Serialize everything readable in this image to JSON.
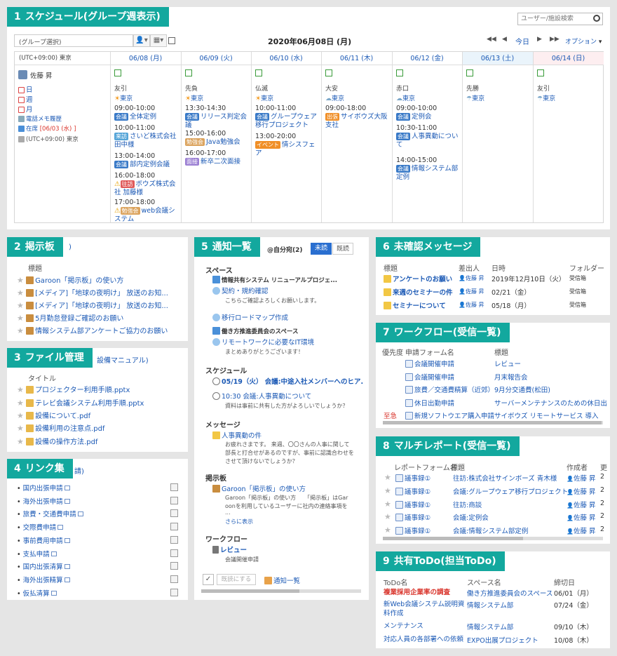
{
  "colors": {
    "accent": "#13a89e",
    "link": "#1b59b5",
    "red": "#d9342b"
  },
  "p1": {
    "num": "1",
    "title": "スケジュール(グループ週表示)",
    "search_placeholder": "ユーザー/施設検索",
    "group_select": "(グループ選択)",
    "date": "2020年06月08日 (月)",
    "today": "今日",
    "option": "オプション",
    "tz": "(UTC+09:00) 東京",
    "days": [
      {
        "label": "06/08 (月)",
        "rokuyo": "友引",
        "weather": "東京"
      },
      {
        "label": "06/09 (火)",
        "rokuyo": "先負",
        "weather": "東京"
      },
      {
        "label": "06/10 (水)",
        "rokuyo": "仏滅",
        "weather": "東京"
      },
      {
        "label": "06/11 (木)",
        "rokuyo": "大安",
        "weather": "東京"
      },
      {
        "label": "06/12 (金)",
        "rokuyo": "赤口",
        "weather": "東京"
      },
      {
        "label": "06/13 (土)",
        "rokuyo": "先勝",
        "weather": "東京"
      },
      {
        "label": "06/14 (日)",
        "rokuyo": "友引",
        "weather": "東京"
      }
    ],
    "user": {
      "name": "佐藤 昇",
      "links": [
        "日",
        "週",
        "月",
        "電話メモ履歴"
      ],
      "status_prefix": "在席",
      "status_date": "[06/03 (水) ]",
      "tz": "(UTC+09:00) 東京"
    },
    "events": {
      "d0": [
        {
          "time": "09:00-10:00",
          "badge": "会議",
          "text": "全体定例"
        },
        {
          "time": "10:00-11:00",
          "badge": "来訪",
          "text": "さいど株式会社 田中様"
        },
        {
          "time": "13:00-14:00",
          "badge": "会議",
          "text": "部内定例会議"
        },
        {
          "time": "16:00-18:00",
          "badge": "往訪",
          "text": "ボウズ株式会社 加藤様"
        },
        {
          "time": "17:00-18:00",
          "badge": "勉強会",
          "text": "web会議システム"
        }
      ],
      "d1": [
        {
          "time": "13:30-14:30",
          "badge": "会議",
          "text": "リリース判定会議"
        },
        {
          "time": "15:00-16:00",
          "badge": "勉強会",
          "text": "Java勉強会"
        },
        {
          "time": "16:00-17:00",
          "badge": "面接",
          "text": "新卒二次面接"
        }
      ],
      "d2": [
        {
          "time": "10:00-11:00",
          "badge": "会議",
          "text": "グループウェア移行プロジェクト"
        },
        {
          "time": "13:00-20:00",
          "badge": "イベント",
          "text": "情シスフェア"
        }
      ],
      "d3": [
        {
          "time": "09:00-18:00",
          "badge": "出張",
          "text": "サイボウズ大阪支社"
        }
      ],
      "d4": [
        {
          "time": "09:00-10:00",
          "badge": "会議",
          "text": "定例会"
        },
        {
          "time": "10:30-11:00",
          "badge": "会議",
          "text": "人事異動について"
        },
        {
          "time": "14:00-15:00",
          "badge": "会議",
          "text": "情報システム部定例"
        }
      ]
    }
  },
  "p2": {
    "num": "2",
    "title": "掲示板",
    "sub": ")",
    "col": "標題",
    "items": [
      "Garoon「掲示板」の使い方",
      "[メディア]「地球の夜明け」 放送のお知...",
      "[メディア]「地球の夜明け」 放送のお知...",
      "5月勤怠登録ご確認のお願い",
      "情報システム部アンケートご協力のお願い"
    ]
  },
  "p3": {
    "num": "3",
    "title": "ファイル管理",
    "sub": "設備マニュアル)",
    "col": "タイトル",
    "items": [
      "プロジェクター利用手順.pptx",
      "テレビ会議システム利用手順.pptx",
      "設備について.pdf",
      "設備利用の注意点.pdf",
      "設備の操作方法.pdf"
    ]
  },
  "p4": {
    "num": "4",
    "title": "リンク集",
    "sub": "請)",
    "items": [
      "国内出張申請",
      "海外出張申請",
      "旅費・交通費申請",
      "交際費申請",
      "事前費用申請",
      "支払申請",
      "国内出張清算",
      "海外出張精算",
      "仮払清算"
    ]
  },
  "p5": {
    "num": "5",
    "title": "通知一覧",
    "self": "@自分宛(2)",
    "tab_unread": "未読",
    "tab_read": "既読",
    "sections": {
      "space": "スペース",
      "schedule": "スケジュール",
      "message": "メッセージ",
      "board": "掲示板",
      "workflow": "ワークフロー"
    },
    "space_items": [
      {
        "group": "情報共有システム リニューアルプロジェ...",
        "title": "契約・規約確認",
        "body": "こちらご確認よろしくお願いします。"
      },
      {
        "title": "移行ロードマップ作成"
      },
      {
        "group": "働き方推進委員会のスペース",
        "title": "リモートワークに必要なIT環境",
        "body": "まとめありがとうございます！"
      }
    ],
    "sched_items": [
      {
        "title": "05/19（火） 会議:中途入社メンバーへのヒア..."
      },
      {
        "title": "10:30 会議:人事異動について",
        "body": "資料は事前に共有した方がよろしいでしょうか？"
      }
    ],
    "msg_item": {
      "title": "人事異動の件",
      "body": [
        "お疲れさまです。 来週、〇〇さんの人事に関して",
        "部長と打合せがあるのですが、事前に認識合わせを",
        "させて頂けないでしょうか？"
      ]
    },
    "board_item": {
      "title": "Garoon「掲示板」の使い方",
      "body": [
        "Garoon「掲示板」の使い方　　「掲示板」はGar",
        "oonを利用しているユーザーに社内の連絡事項を",
        "..."
      ],
      "more": "さらに表示"
    },
    "wf_item": {
      "title": "レビュー",
      "body": "会議開催申請"
    },
    "mark_read": "既読にする",
    "footer_link": "通知一覧"
  },
  "p6": {
    "num": "6",
    "title": "未確認メッセージ",
    "cols": [
      "標題",
      "差出人",
      "日時",
      "フォルダー"
    ],
    "rows": [
      {
        "title": "アンケートのお願い",
        "from": "佐藤 昇",
        "date": "2019年12月10日（火）",
        "folder": "受信箱"
      },
      {
        "title": "来週のセミナーの件",
        "from": "佐藤 昇",
        "date": "02/21（金）",
        "folder": "受信箱"
      },
      {
        "title": "セミナーについて",
        "from": "佐藤 昇",
        "date": "05/18（月）",
        "folder": "受信箱"
      }
    ]
  },
  "p7": {
    "num": "7",
    "title": "ワークフロー(受信一覧)",
    "cols": [
      "優先度",
      "申請フォーム名",
      "標題"
    ],
    "rows": [
      {
        "pri": "",
        "form": "会議開催申請",
        "title": "レビュー"
      },
      {
        "pri": "",
        "form": "会議開催申請",
        "title": "月末報告会"
      },
      {
        "pri": "",
        "form": "旅費／交通費精算（近郊）",
        "title": "9月分交通費(松田)"
      },
      {
        "pri": "",
        "form": "休日出勤申請",
        "title": "サーバーメンテナンスのための休日出"
      },
      {
        "pri": "至急",
        "form": "新規ソフトウエア購入申請",
        "title": "サイボウズ リモートサービス 導入"
      }
    ]
  },
  "p8": {
    "num": "8",
    "title": "マルチレポート(受信一覧)",
    "cols": [
      "レポートフォーム名",
      "標題",
      "作成者",
      "更"
    ],
    "rows": [
      {
        "form": "議事録①",
        "title": "往訪:株式会社サインボーズ 青木様",
        "author": "佐藤 昇",
        "d": "2"
      },
      {
        "form": "議事録①",
        "title": "会議:グループウェア移行プロジェクト",
        "author": "佐藤 昇",
        "d": "2"
      },
      {
        "form": "議事録①",
        "title": "往訪:商談",
        "author": "佐藤 昇",
        "d": "2"
      },
      {
        "form": "議事録①",
        "title": "会議:定例会",
        "author": "佐藤 昇",
        "d": "2"
      },
      {
        "form": "議事録①",
        "title": "会議:情報システム部定例",
        "author": "佐藤 昇",
        "d": "2"
      }
    ]
  },
  "p9": {
    "num": "9",
    "title": "共有ToDo(担当ToDo)",
    "cols": [
      "ToDo名",
      "スペース名",
      "締切日"
    ],
    "rows": [
      {
        "name": "複業採用企業率の調査",
        "space": "働き方推進委員会のスペース",
        "due": "06/01（月）"
      },
      {
        "name": "新Web会議システム説明資料作成",
        "space": "情報システム部",
        "due": "07/24（金）"
      },
      {
        "name": "メンテナンス",
        "space": "情報システム部",
        "due": "09/10（木）"
      },
      {
        "name": "対応人員の各部署への依頼",
        "space": "EXPO出展プロジェクト",
        "due": "10/08（木）"
      }
    ]
  }
}
